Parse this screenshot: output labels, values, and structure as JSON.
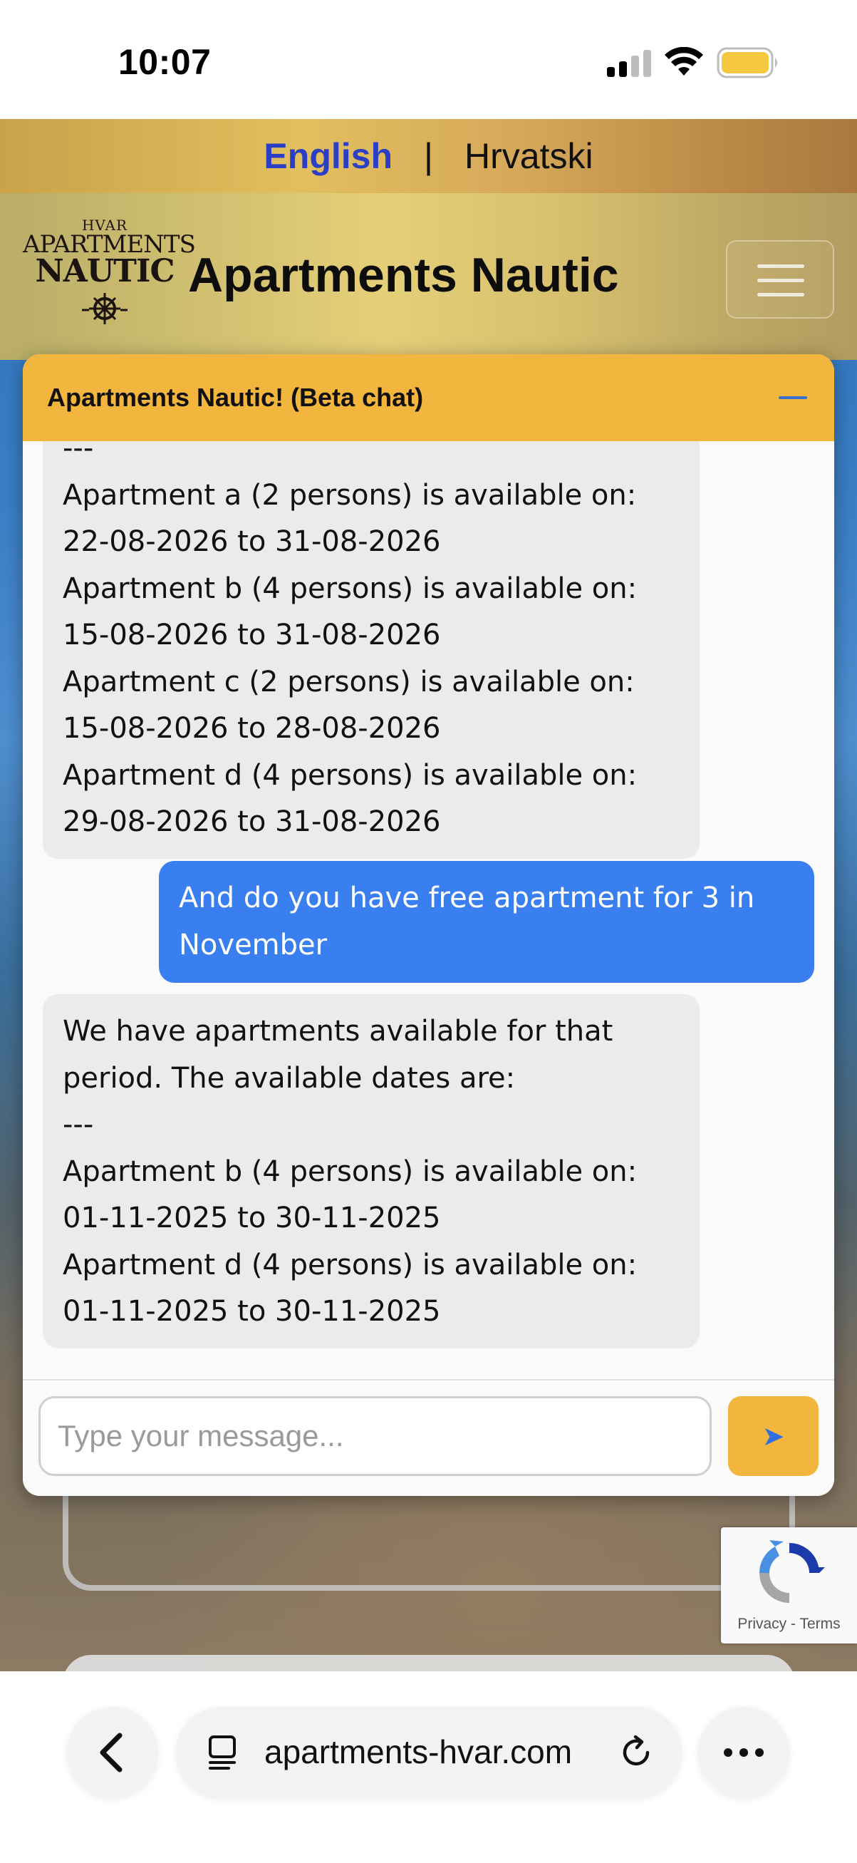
{
  "status_bar": {
    "time": "10:07",
    "battery_color": "#f5c842"
  },
  "site": {
    "languages": {
      "english": "English",
      "separator": "|",
      "croatian": "Hrvatski"
    },
    "logo": {
      "line1": "HVAR",
      "line2": "APARTMENTS",
      "line3": "NAUTIC",
      "icon": "ship-wheel-icon"
    },
    "brand_title": "Apartments Nautic",
    "accent_gold": "#f2b53d",
    "link_blue": "#2a3fc4"
  },
  "chat": {
    "title": "Apartments Nautic! (Beta chat)",
    "messages": [
      {
        "role": "bot",
        "text": "---\nApartment a (2 persons) is available on: 22-08-2026 to 31-08-2026\nApartment b (4 persons) is available on: 15-08-2026 to 31-08-2026\nApartment c (2 persons) is available on: 15-08-2026 to 28-08-2026\nApartment d (4 persons) is available on: 29-08-2026 to 31-08-2026"
      },
      {
        "role": "user",
        "text": "And do you have free apartment for 3 in November"
      },
      {
        "role": "bot",
        "text": "We have apartments available for that period. The available dates are:\n---\nApartment b (4 persons) is available on: 01-11-2025 to 30-11-2025\nApartment d (4 persons) is available on: 01-11-2025 to 30-11-2025"
      }
    ],
    "input_placeholder": "Type your message...",
    "input_value": "",
    "send_icon": "send-arrow-icon",
    "user_bubble_color": "#3a7ff0",
    "bot_bubble_color": "#ebebeb"
  },
  "recaptcha": {
    "privacy": "Privacy",
    "separator": "-",
    "terms": "Terms"
  },
  "browser": {
    "url": "apartments-hvar.com"
  }
}
